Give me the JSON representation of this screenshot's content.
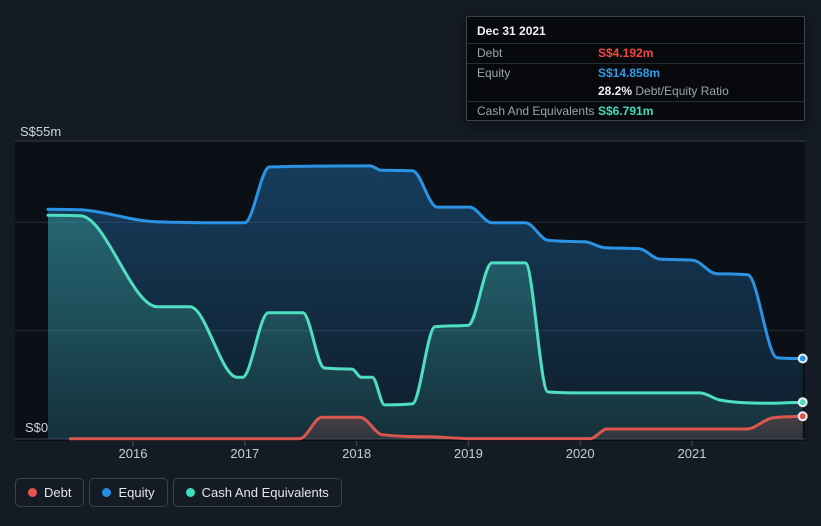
{
  "page": {
    "background": "#151b24"
  },
  "tooltip": {
    "date": "Dec 31 2021",
    "rows": [
      {
        "label": "Debt",
        "value": "S$4.192m",
        "color": "#f4473c"
      },
      {
        "label": "Equity",
        "value": "S$14.858m",
        "color": "#2f9ce8"
      },
      {
        "label": "Cash And Equivalents",
        "value": "S$6.791m",
        "color": "#3eddbe"
      }
    ],
    "ratio_bold": "28.2%",
    "ratio_text": " Debt/Equity Ratio"
  },
  "legend": {
    "items": [
      {
        "label": "Debt",
        "color": "#e5534d"
      },
      {
        "label": "Equity",
        "color": "#2590e2"
      },
      {
        "label": "Cash And Equivalents",
        "color": "#3edcbc"
      }
    ]
  },
  "chart_data": {
    "type": "area",
    "title": "",
    "currency_unit": "S$m",
    "x_axis": {
      "tick_labels": [
        "2016",
        "2017",
        "2018",
        "2019",
        "2020",
        "2021"
      ],
      "tick_years": [
        2016,
        2017,
        2018,
        2019,
        2020,
        2021
      ]
    },
    "y_axis": {
      "top_label": "S$55m",
      "bottom_label": "S$0",
      "min": 0,
      "max": 55,
      "gridline_values": [
        55,
        40,
        20,
        0
      ]
    },
    "legend_position": "bottom-left",
    "grid": true,
    "series": [
      {
        "name": "Debt",
        "color": "#d9574f",
        "final_value_label": "S$4.192m",
        "points": [
          [
            2015.44,
            0.05
          ],
          [
            2017.49,
            0.05
          ],
          [
            2017.69,
            4.0
          ],
          [
            2018.03,
            4.0
          ],
          [
            2018.23,
            0.8
          ],
          [
            2018.65,
            0.4
          ],
          [
            2019.01,
            0.08
          ],
          [
            2020.09,
            0.08
          ],
          [
            2020.24,
            1.85
          ],
          [
            2021.49,
            1.85
          ],
          [
            2021.72,
            3.9
          ],
          [
            2021.99,
            4.192
          ]
        ]
      },
      {
        "name": "Equity",
        "color": "#2b93e3",
        "final_value_label": "S$14.858m",
        "points": [
          [
            2015.24,
            42.4
          ],
          [
            2015.53,
            42.3
          ],
          [
            2016.2,
            40.1
          ],
          [
            2017.0,
            39.9
          ],
          [
            2017.22,
            50.2
          ],
          [
            2018.12,
            50.4
          ],
          [
            2018.22,
            49.6
          ],
          [
            2018.5,
            49.5
          ],
          [
            2018.72,
            42.8
          ],
          [
            2019.01,
            42.8
          ],
          [
            2019.21,
            39.9
          ],
          [
            2019.51,
            39.9
          ],
          [
            2019.71,
            36.7
          ],
          [
            2020.04,
            36.4
          ],
          [
            2020.22,
            35.3
          ],
          [
            2020.53,
            35.1
          ],
          [
            2020.71,
            33.2
          ],
          [
            2021.01,
            33.0
          ],
          [
            2021.22,
            30.5
          ],
          [
            2021.5,
            30.3
          ],
          [
            2021.76,
            15.0
          ],
          [
            2021.99,
            14.858
          ]
        ]
      },
      {
        "name": "Cash And Equivalents",
        "color": "#4fdec0",
        "final_value_label": "S$6.791m",
        "points": [
          [
            2015.24,
            41.3
          ],
          [
            2015.53,
            41.2
          ],
          [
            2016.22,
            24.4
          ],
          [
            2016.51,
            24.4
          ],
          [
            2016.93,
            11.4
          ],
          [
            2016.98,
            11.4
          ],
          [
            2017.21,
            23.3
          ],
          [
            2017.52,
            23.3
          ],
          [
            2017.71,
            13.1
          ],
          [
            2017.96,
            12.9
          ],
          [
            2018.04,
            11.4
          ],
          [
            2018.14,
            11.4
          ],
          [
            2018.25,
            6.3
          ],
          [
            2018.5,
            6.5
          ],
          [
            2018.7,
            20.7
          ],
          [
            2019.0,
            21.0
          ],
          [
            2019.21,
            32.5
          ],
          [
            2019.51,
            32.5
          ],
          [
            2019.71,
            8.7
          ],
          [
            2020.0,
            8.5
          ],
          [
            2021.07,
            8.5
          ],
          [
            2021.25,
            7.2
          ],
          [
            2021.7,
            6.6
          ],
          [
            2021.99,
            6.791
          ]
        ]
      }
    ]
  }
}
